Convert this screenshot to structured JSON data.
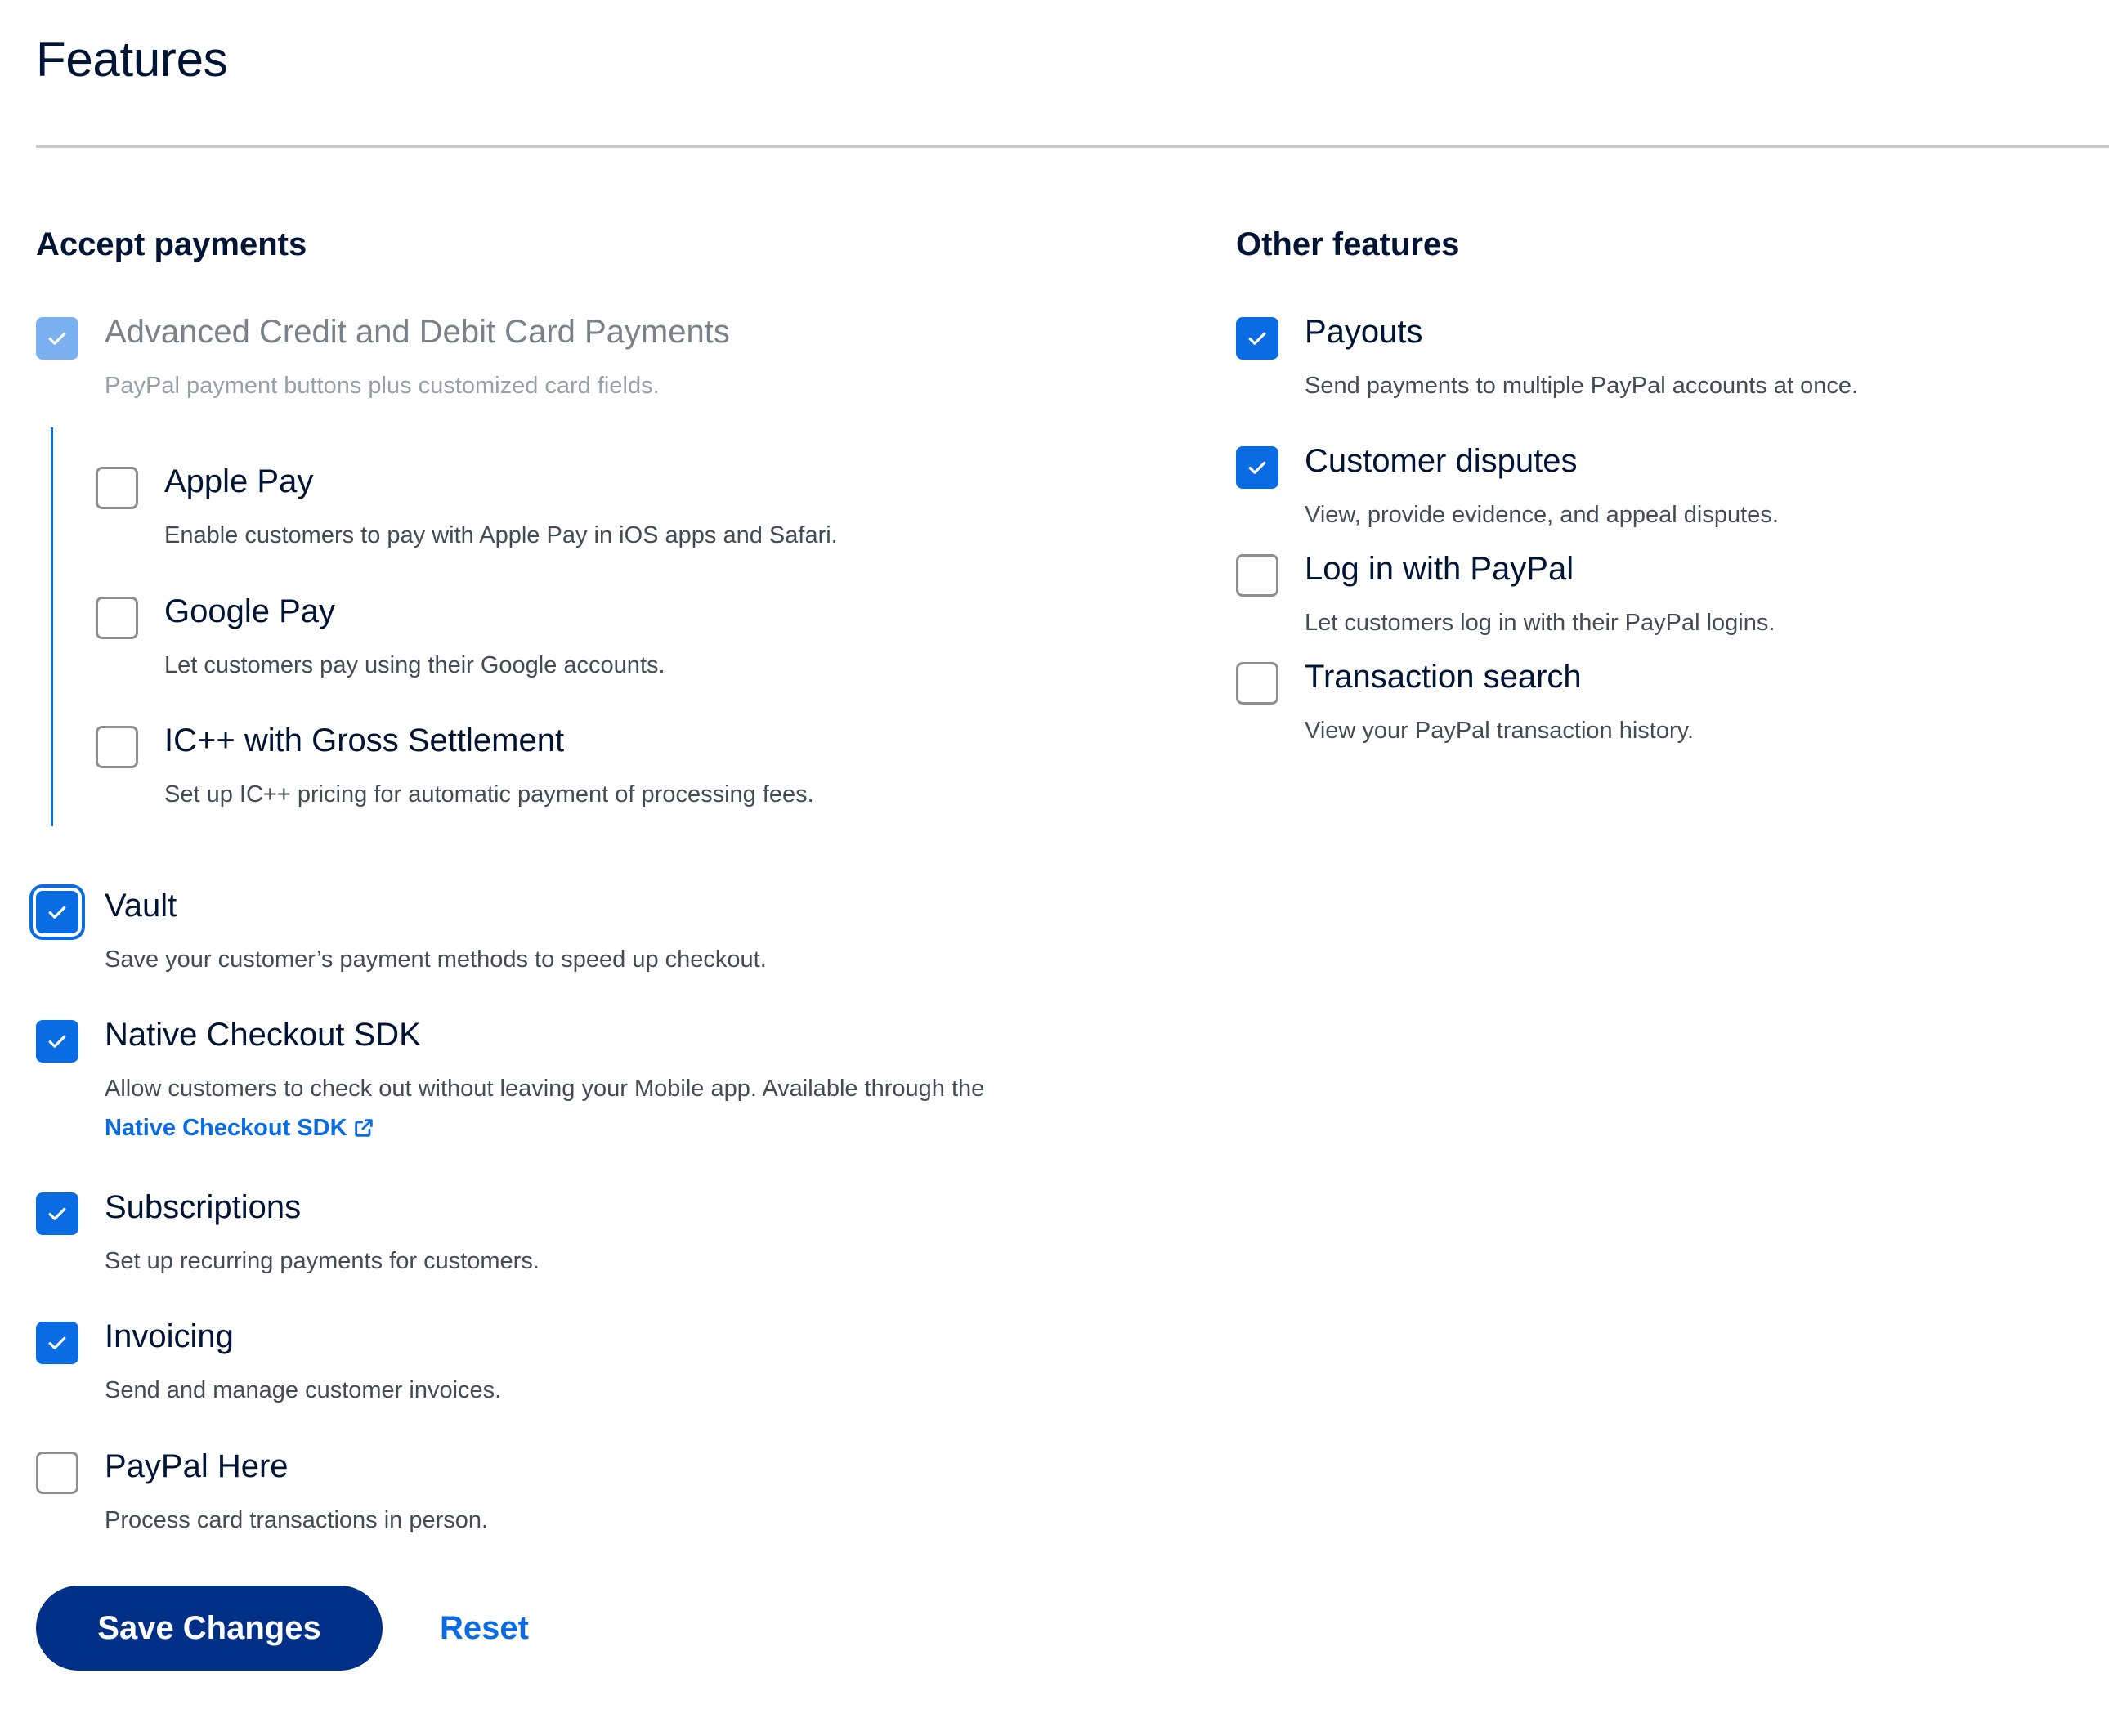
{
  "page": {
    "title": "Features"
  },
  "accept_payments": {
    "title": "Accept payments",
    "advanced_card": {
      "label": "Advanced Credit and Debit Card Payments",
      "desc": "PayPal payment buttons plus customized card fields.",
      "checked": true,
      "disabled": true
    },
    "sub_items": [
      {
        "label": "Apple Pay",
        "desc": "Enable customers to pay with Apple Pay in iOS apps and Safari.",
        "checked": false
      },
      {
        "label": "Google Pay",
        "desc": "Let customers pay using their Google accounts.",
        "checked": false
      },
      {
        "label": "IC++ with Gross Settlement",
        "desc": "Set up IC++ pricing for automatic payment of processing fees.",
        "checked": false
      }
    ],
    "items": [
      {
        "label": "Vault",
        "desc": "Save your customer’s payment methods to speed up checkout.",
        "checked": true,
        "focused": true
      },
      {
        "label": "Native Checkout SDK",
        "desc": "Allow customers to check out without leaving your Mobile app. Available through the",
        "link": "Native Checkout SDK",
        "checked": true
      },
      {
        "label": "Subscriptions",
        "desc": "Set up recurring payments for customers.",
        "checked": true
      },
      {
        "label": "Invoicing",
        "desc": "Send and manage customer invoices.",
        "checked": true
      },
      {
        "label": "PayPal Here",
        "desc": "Process card transactions in person.",
        "checked": false
      }
    ]
  },
  "other_features": {
    "title": "Other features",
    "items": [
      {
        "label": "Payouts",
        "desc": "Send payments to multiple PayPal accounts at once.",
        "checked": true
      },
      {
        "label": "Customer disputes",
        "desc": "View, provide evidence, and appeal disputes.",
        "checked": true
      },
      {
        "label": "Log in with PayPal",
        "desc": "Let customers log in with their PayPal logins.",
        "checked": false
      },
      {
        "label": "Transaction search",
        "desc": "View your PayPal transaction history.",
        "checked": false
      }
    ]
  },
  "actions": {
    "save_label": "Save Changes",
    "reset_label": "Reset"
  },
  "colors": {
    "primary": "#0a6ce3",
    "navy": "#003087",
    "disabled": "#7aaff0"
  },
  "icons": {
    "check": "check-icon",
    "external": "external-link-icon"
  }
}
